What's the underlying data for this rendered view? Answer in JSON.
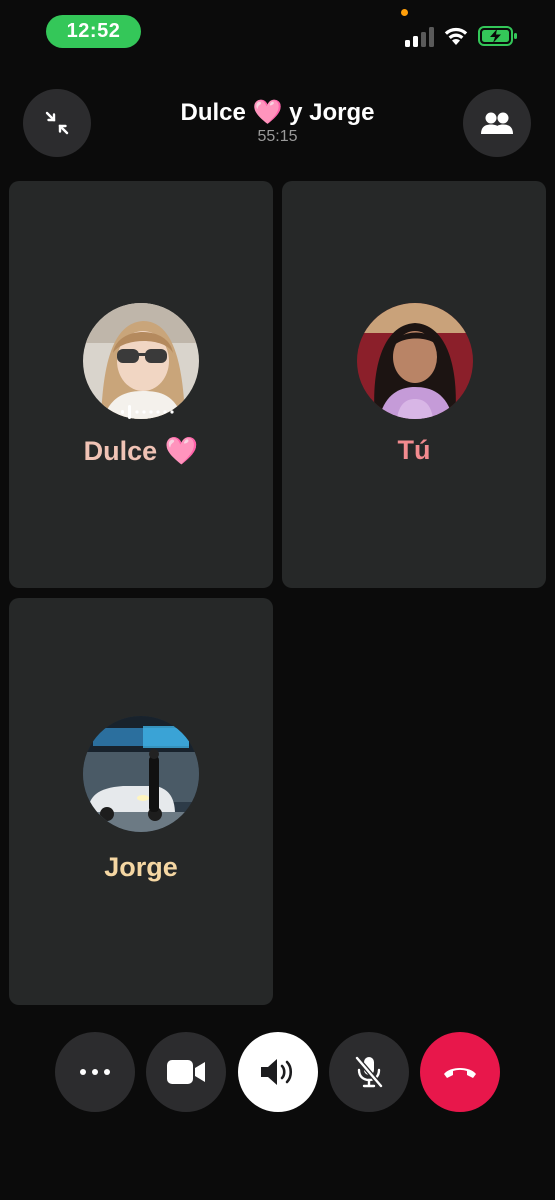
{
  "status_bar": {
    "time": "12:52",
    "signal_icon": "cellular-signal-icon",
    "wifi_icon": "wifi-icon",
    "battery_icon": "battery-charging-icon",
    "time_pill_color": "#34c759"
  },
  "header": {
    "title_part1": "Dulce",
    "title_heart": "🩷",
    "title_part2": "y Jorge",
    "timer": "55:15",
    "minimize_icon": "minimize-arrows-icon",
    "participants_icon": "people-icon"
  },
  "participants": [
    {
      "name": "Dulce",
      "emoji": "🩷",
      "speaking": true,
      "name_color": "#f0c3b5"
    },
    {
      "name": "Tú",
      "emoji": "",
      "speaking": false,
      "name_color": "#f28b8f"
    },
    {
      "name": "Jorge",
      "emoji": "",
      "speaking": false,
      "name_color": "#f5d7a3"
    }
  ],
  "controls": [
    {
      "name": "more",
      "icon": "ellipsis-icon"
    },
    {
      "name": "video",
      "icon": "video-camera-icon"
    },
    {
      "name": "speaker",
      "icon": "speaker-icon",
      "active": true
    },
    {
      "name": "mute",
      "icon": "microphone-muted-icon"
    },
    {
      "name": "end-call",
      "icon": "phone-hangup-icon",
      "color": "#e8174b"
    }
  ]
}
